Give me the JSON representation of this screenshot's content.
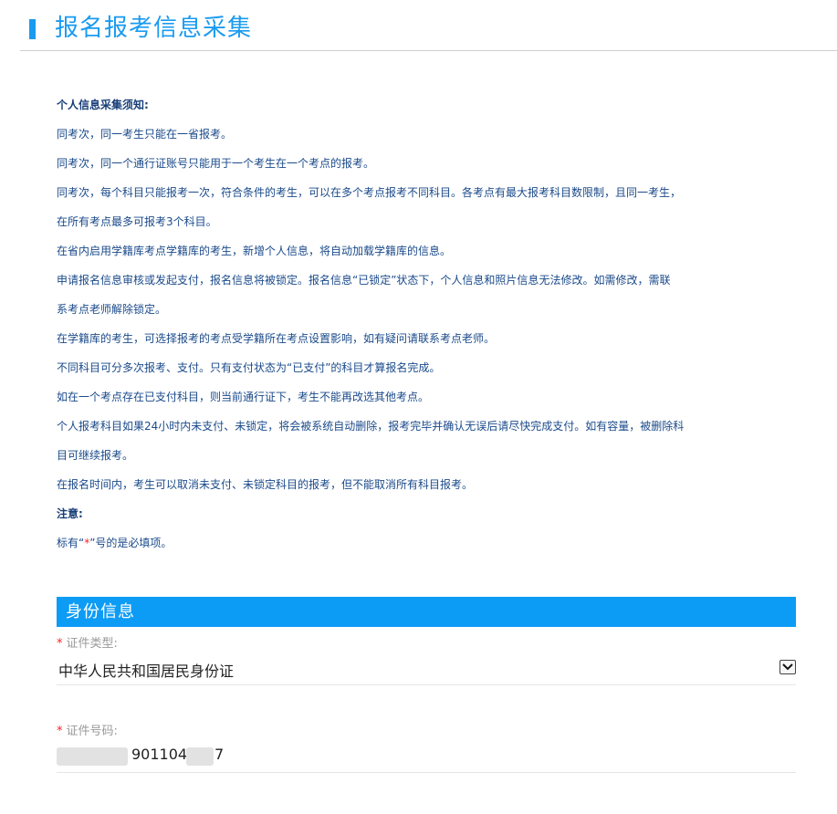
{
  "header": {
    "title": "报名报考信息采集"
  },
  "notice": {
    "heading": "个人信息采集须知:",
    "lines": [
      "同考次，同一考生只能在一省报考。",
      "同考次，同一个通行证账号只能用于一个考生在一个考点的报考。",
      "同考次，每个科目只能报考一次，符合条件的考生，可以在多个考点报考不同科目。各考点有最大报考科目数限制，且同一考生，",
      "在所有考点最多可报考3个科目。",
      "在省内启用学籍库考点学籍库的考生，新增个人信息，将自动加载学籍库的信息。",
      "申请报名信息审核或发起支付，报名信息将被锁定。报名信息“已锁定”状态下，个人信息和照片信息无法修改。如需修改，需联",
      "系考点老师解除锁定。",
      "在学籍库的考生，可选择报考的考点受学籍所在考点设置影响，如有疑问请联系考点老师。",
      "不同科目可分多次报考、支付。只有支付状态为“已支付”的科目才算报名完成。",
      "如在一个考点存在已支付科目，则当前通行证下，考生不能再改选其他考点。",
      "个人报考科目如果24小时内未支付、未锁定，将会被系统自动删除，报考完毕并确认无误后请尽快完成支付。如有容量，被删除科",
      "目可继续报考。",
      "在报名时间内，考生可以取消未支付、未锁定科目的报考，但不能取消所有科目报考。"
    ],
    "note_heading": "注意:",
    "required_prefix": "标有“",
    "required_star": "*",
    "required_suffix": "”号的是必填项。"
  },
  "identity": {
    "section_title": "身份信息",
    "required_mark": "*",
    "id_type_label": "证件类型:",
    "id_type_value": "中华人民共和国居民身份证",
    "id_number_label": "证件号码:",
    "id_number_visible_mid": "901104",
    "id_number_visible_end": "7"
  },
  "colors": {
    "accent": "#1a9bf0",
    "section_bg": "#0c9cf5",
    "required": "#ff2020",
    "notice_text": "#1a4a8a"
  }
}
